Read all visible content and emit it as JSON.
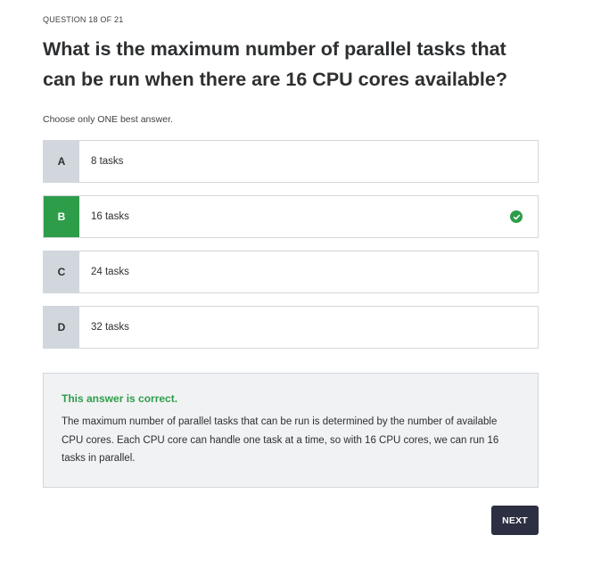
{
  "quiz": {
    "counter": "QUESTION 18 OF 21",
    "question": "What is the maximum number of parallel tasks that can be run when there are 16 CPU cores available?",
    "instruction": "Choose only ONE best answer.",
    "options": [
      {
        "letter": "A",
        "text": "8 tasks",
        "correct": false
      },
      {
        "letter": "B",
        "text": "16 tasks",
        "correct": true
      },
      {
        "letter": "C",
        "text": "24 tasks",
        "correct": false
      },
      {
        "letter": "D",
        "text": "32 tasks",
        "correct": false
      }
    ],
    "correct_icon": "check-circle-icon"
  },
  "feedback": {
    "status": "This answer is correct.",
    "explanation": "The maximum number of parallel tasks that can be run is determined by the number of available CPU cores. Each CPU core can handle one task at a time, so with 16 CPU cores, we can run 16 tasks in parallel."
  },
  "actions": {
    "next_label": "NEXT"
  },
  "colors": {
    "correct": "#2e9d4a",
    "letter_bg": "#d1d7dc",
    "button_bg": "#2d2f42",
    "feedback_bg": "#f1f2f3"
  }
}
